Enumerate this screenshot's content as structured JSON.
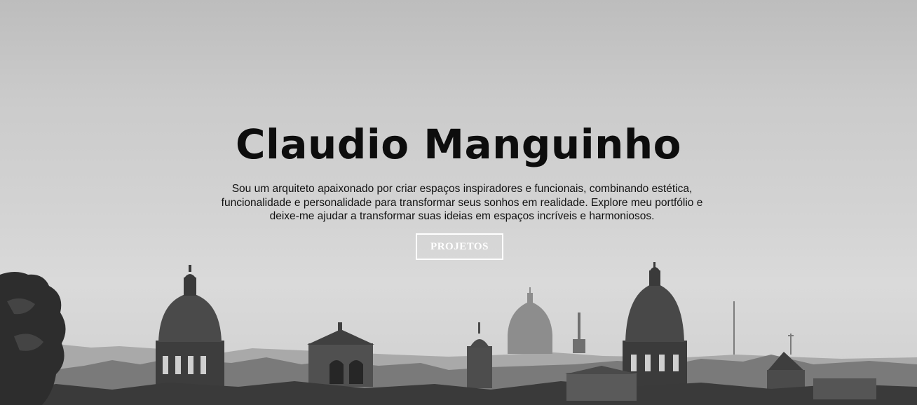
{
  "hero": {
    "title": "Claudio Manguinho",
    "description": "Sou um arquiteto apaixonado por criar espaços inspiradores e funcionais, combinando estética, funcionalidade e personalidade para transformar seus sonhos em realidade. Explore meu portfólio e deixe-me ajudar a transformar suas ideias em espaços incríveis e harmoniosos.",
    "cta_label": "PROJETOS"
  },
  "colors": {
    "title": "#0d0d0d",
    "button_border": "#ffffff",
    "button_text": "#ffffff"
  }
}
